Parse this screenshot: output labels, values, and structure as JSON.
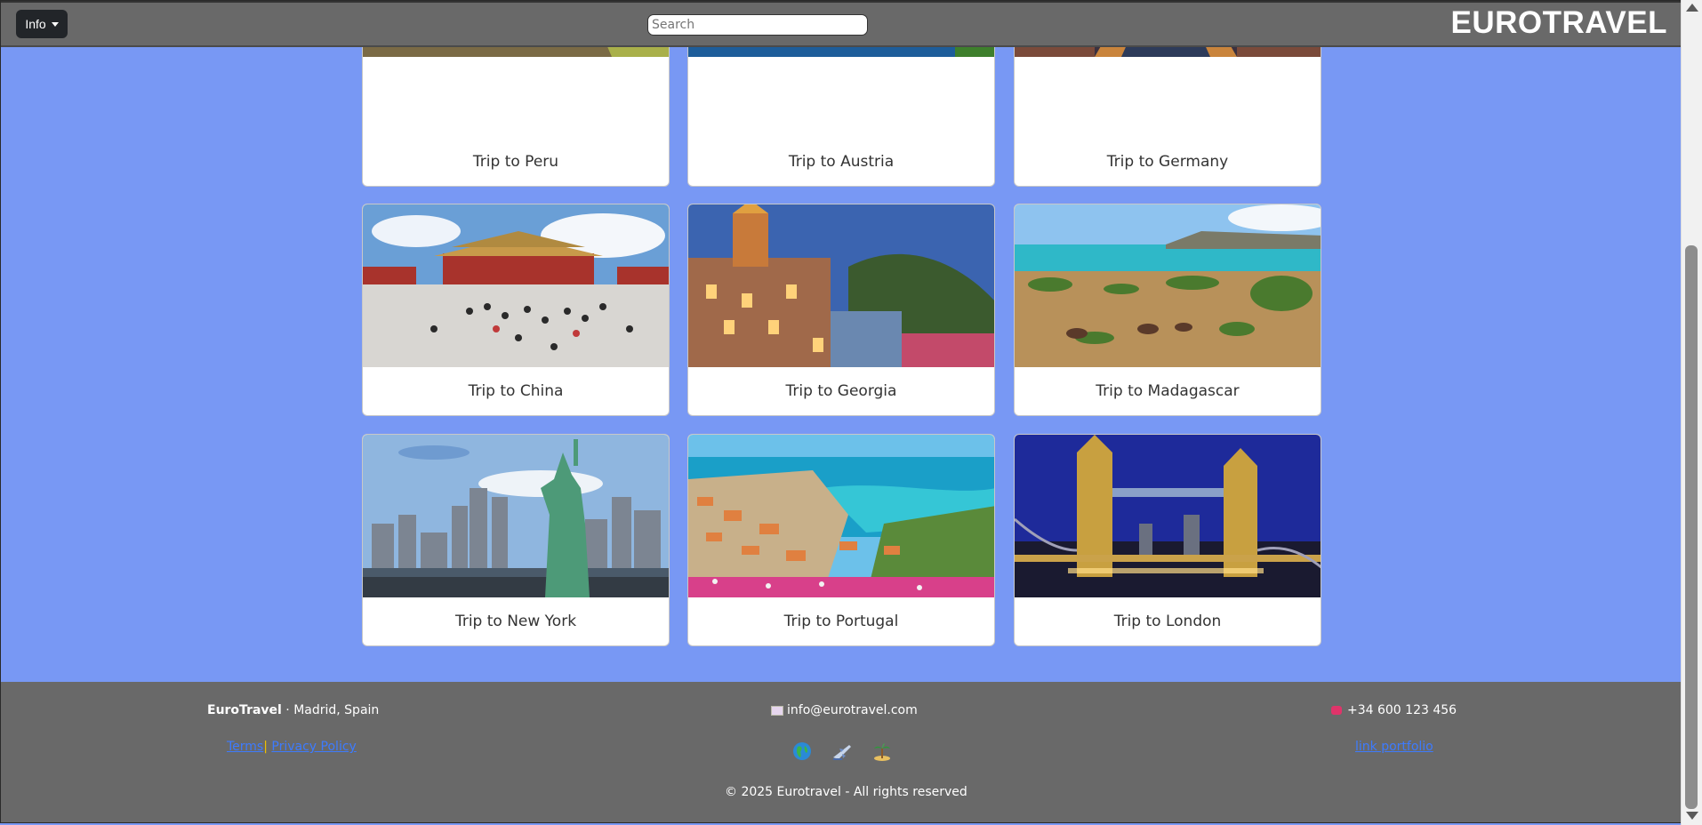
{
  "navbar": {
    "info_label": "Info",
    "search_placeholder": "Search",
    "brand": "EUROTRAVEL"
  },
  "trips": [
    {
      "label": "Trip to Peru",
      "image": "machu-picchu-ruins"
    },
    {
      "label": "Trip to Austria",
      "image": "hallstatt-lake-village"
    },
    {
      "label": "Trip to Germany",
      "image": "city-canal-night"
    },
    {
      "label": "Trip to China",
      "image": "forbidden-city-crowd"
    },
    {
      "label": "Trip to Georgia",
      "image": "tbilisi-old-town-night"
    },
    {
      "label": "Trip to Madagascar",
      "image": "savanna-coast-zebu"
    },
    {
      "label": "Trip to New York",
      "image": "statue-of-liberty-skyline"
    },
    {
      "label": "Trip to Portugal",
      "image": "madeira-coast-town"
    },
    {
      "label": "Trip to London",
      "image": "tower-bridge-night"
    }
  ],
  "footer": {
    "company_name": "EuroTravel",
    "company_location": " · Madrid, Spain",
    "email_icon": "envelope-icon",
    "email": "info@eurotravel.com",
    "phone_icon": "telephone-icon",
    "phone": "+34 600 123 456",
    "terms": "Terms",
    "separator": "|",
    "privacy": "Privacy Policy",
    "social_icons": [
      "globe-icon",
      "airplane-icon",
      "island-icon"
    ],
    "portfolio": "link portfolio",
    "copyright": "© 2025 Eurotravel - All rights reserved"
  },
  "colors": {
    "page_background": "#7898f4",
    "navbar_footer": "#696969",
    "link": "#3d7bff"
  }
}
